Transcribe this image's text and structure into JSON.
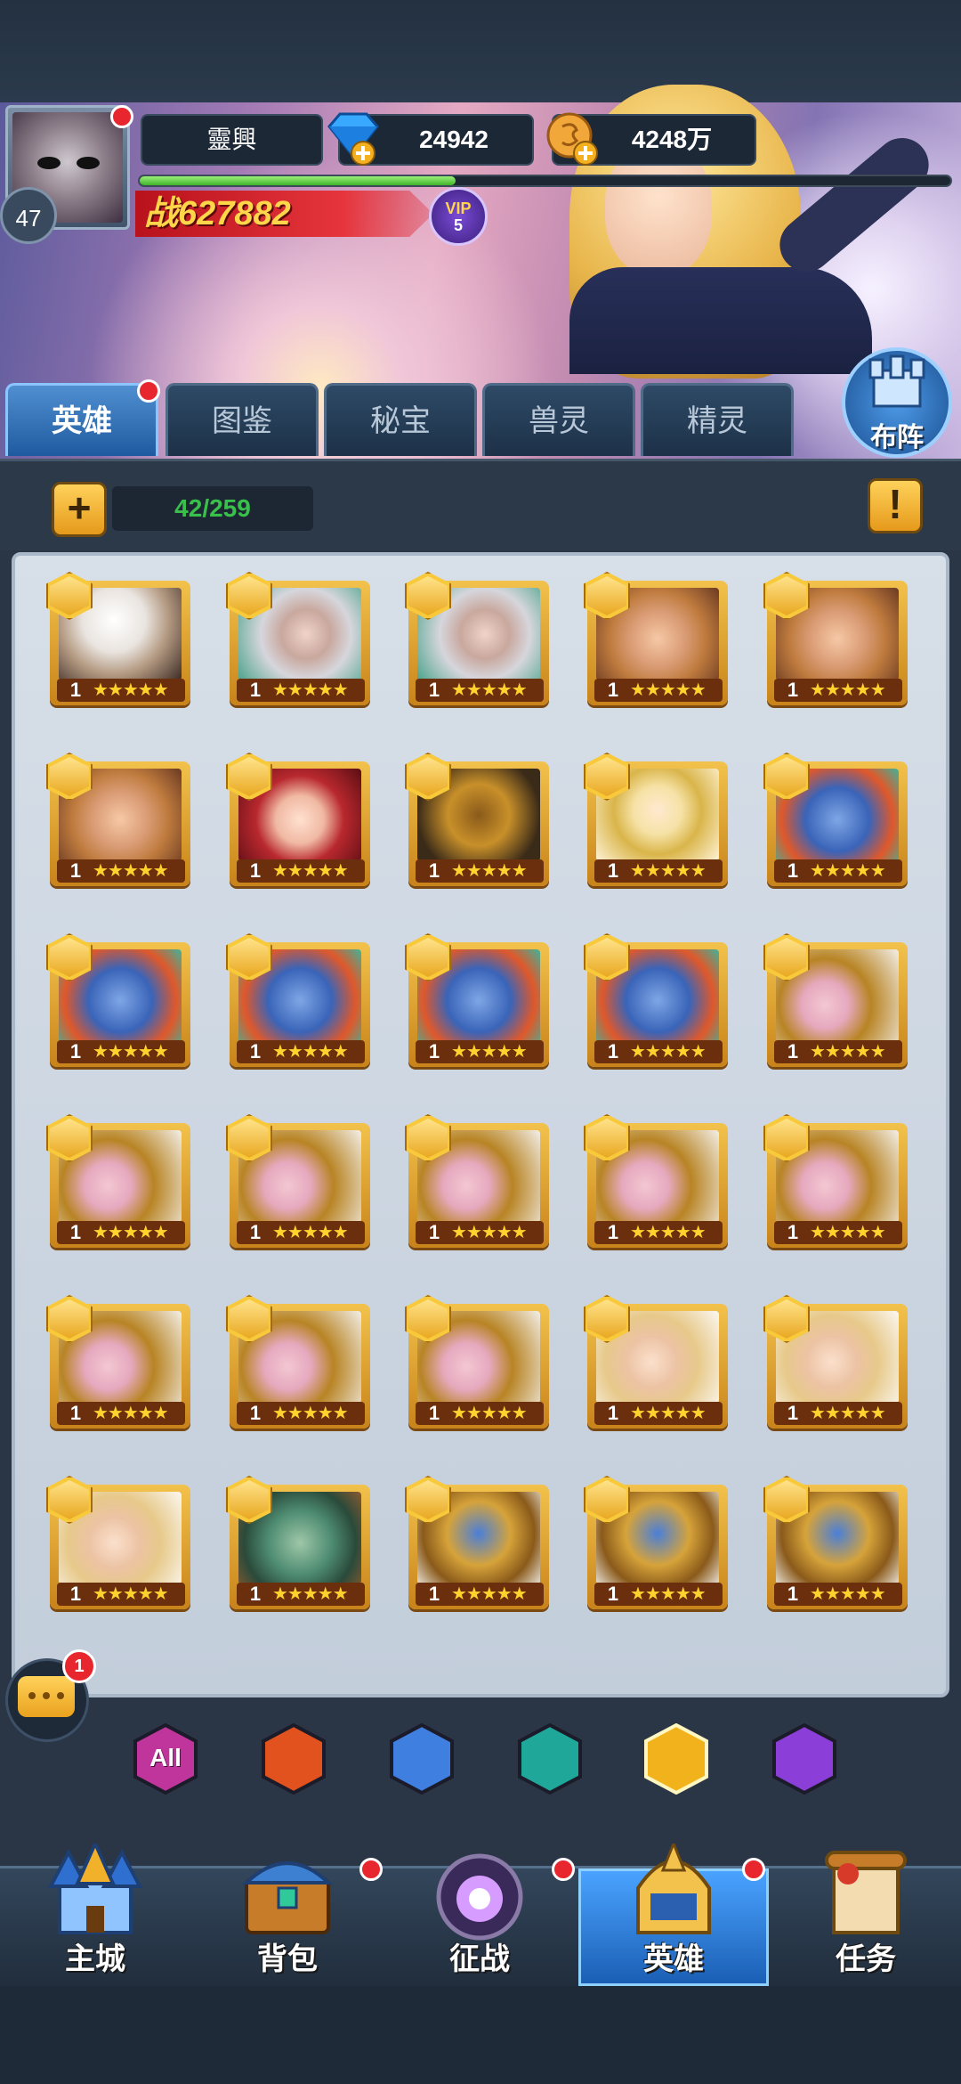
{
  "player": {
    "name": "靈興",
    "level": "47",
    "gems": "24942",
    "coins": "4248万",
    "power_prefix": "战",
    "power": "627882",
    "vip_label": "VIP",
    "vip_level": "5",
    "xp_progress": 0.39
  },
  "tabs": [
    {
      "label": "英雄",
      "active": true
    },
    {
      "label": "图鉴"
    },
    {
      "label": "秘宝"
    },
    {
      "label": "兽灵"
    },
    {
      "label": "精灵"
    }
  ],
  "formation_label": "布阵",
  "hero_count": "42/259",
  "add_button": "+",
  "info_button": "!",
  "heroes": [
    {
      "level": "1",
      "stars": "★★★★★",
      "portrait": "white-hair-swordsman"
    },
    {
      "level": "1",
      "stars": "★★★★★",
      "portrait": "silver-hair-vampire"
    },
    {
      "level": "1",
      "stars": "★★★★★",
      "portrait": "silver-hair-vampire"
    },
    {
      "level": "1",
      "stars": "★★★★★",
      "portrait": "elf-prince"
    },
    {
      "level": "1",
      "stars": "★★★★★",
      "portrait": "elf-prince"
    },
    {
      "level": "1",
      "stars": "★★★★★",
      "portrait": "elf-prince"
    },
    {
      "level": "1",
      "stars": "★★★★★",
      "portrait": "red-hair-girl"
    },
    {
      "level": "1",
      "stars": "★★★★★",
      "portrait": "golden-hood-mage"
    },
    {
      "level": "1",
      "stars": "★★★★★",
      "portrait": "golden-armor-knight"
    },
    {
      "level": "1",
      "stars": "★★★★★",
      "portrait": "blue-troll"
    },
    {
      "level": "1",
      "stars": "★★★★★",
      "portrait": "blue-troll"
    },
    {
      "level": "1",
      "stars": "★★★★★",
      "portrait": "blue-troll"
    },
    {
      "level": "1",
      "stars": "★★★★★",
      "portrait": "blue-troll"
    },
    {
      "level": "1",
      "stars": "★★★★★",
      "portrait": "blue-troll"
    },
    {
      "level": "1",
      "stars": "★★★★★",
      "portrait": "masked-assassin"
    },
    {
      "level": "1",
      "stars": "★★★★★",
      "portrait": "masked-assassin"
    },
    {
      "level": "1",
      "stars": "★★★★★",
      "portrait": "masked-assassin"
    },
    {
      "level": "1",
      "stars": "★★★★★",
      "portrait": "masked-assassin"
    },
    {
      "level": "1",
      "stars": "★★★★★",
      "portrait": "masked-assassin"
    },
    {
      "level": "1",
      "stars": "★★★★★",
      "portrait": "masked-assassin"
    },
    {
      "level": "1",
      "stars": "★★★★★",
      "portrait": "masked-assassin"
    },
    {
      "level": "1",
      "stars": "★★★★★",
      "portrait": "masked-assassin"
    },
    {
      "level": "1",
      "stars": "★★★★★",
      "portrait": "masked-assassin"
    },
    {
      "level": "1",
      "stars": "★★★★★",
      "portrait": "blonde-priestess"
    },
    {
      "level": "1",
      "stars": "★★★★★",
      "portrait": "blonde-priestess"
    },
    {
      "level": "1",
      "stars": "★★★★★",
      "portrait": "blonde-priestess"
    },
    {
      "level": "1",
      "stars": "★★★★★",
      "portrait": "green-orc"
    },
    {
      "level": "1",
      "stars": "★★★★★",
      "portrait": "armored-golem"
    },
    {
      "level": "1",
      "stars": "★★★★★",
      "portrait": "armored-golem"
    },
    {
      "level": "1",
      "stars": "★★★★★",
      "portrait": "armored-golem"
    }
  ],
  "filters": [
    {
      "label": "All",
      "icon": "all-hexagon-icon",
      "color": "#c0359c"
    },
    {
      "icon": "fire-faction-icon",
      "color": "#e2521f"
    },
    {
      "icon": "cross-faction-icon",
      "color": "#3f7fe0"
    },
    {
      "icon": "skull-faction-icon",
      "color": "#1fa89a"
    },
    {
      "icon": "leaf-faction-icon",
      "color": "#f2b21b",
      "active": true
    },
    {
      "icon": "trident-faction-icon",
      "color": "#8b3fd8"
    }
  ],
  "chat_badge": "1",
  "nav": [
    {
      "label": "主城",
      "icon": "castle-icon"
    },
    {
      "label": "背包",
      "icon": "treasure-chest-icon"
    },
    {
      "label": "征战",
      "icon": "dragon-portal-icon"
    },
    {
      "label": "英雄",
      "icon": "hero-helmet-icon",
      "active": true
    },
    {
      "label": "任务",
      "icon": "scroll-icon"
    }
  ]
}
